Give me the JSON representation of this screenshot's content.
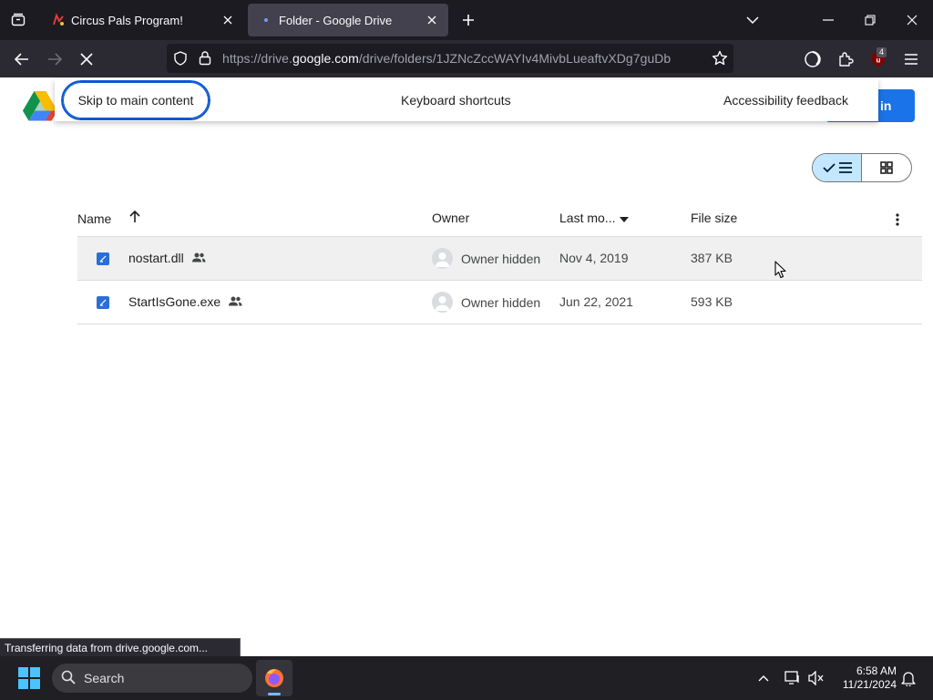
{
  "browser": {
    "tabs": [
      {
        "title": "Circus Pals Program!",
        "active": false
      },
      {
        "title": "Folder - Google Drive",
        "active": true
      }
    ],
    "url": {
      "prefix": "https://drive.",
      "domain": "google.com",
      "path": "/drive/folders/1JZNcZccWAYIv4MivbLueaftvXDg7guDb"
    },
    "extension_badge": "4",
    "status_text": "Transferring data from drive.google.com..."
  },
  "drive": {
    "skip_link": "Skip to main content",
    "keyboard_shortcuts": "Keyboard shortcuts",
    "accessibility_feedback": "Accessibility feedback",
    "signin_label": "in",
    "columns": {
      "name": "Name",
      "owner": "Owner",
      "modified": "Last mo...",
      "size": "File size"
    },
    "files": [
      {
        "name": "nostart.dll",
        "owner": "Owner hidden",
        "modified": "Nov 4, 2019",
        "size": "387 KB"
      },
      {
        "name": "StartIsGone.exe",
        "owner": "Owner hidden",
        "modified": "Jun 22, 2021",
        "size": "593 KB"
      }
    ]
  },
  "taskbar": {
    "search_label": "Search",
    "time": "6:58 AM",
    "date": "11/21/2024"
  },
  "colors": {
    "accent_blue": "#1a73e8",
    "toggle_selected": "#c2e7ff",
    "chrome_dark": "#1c1b22"
  }
}
